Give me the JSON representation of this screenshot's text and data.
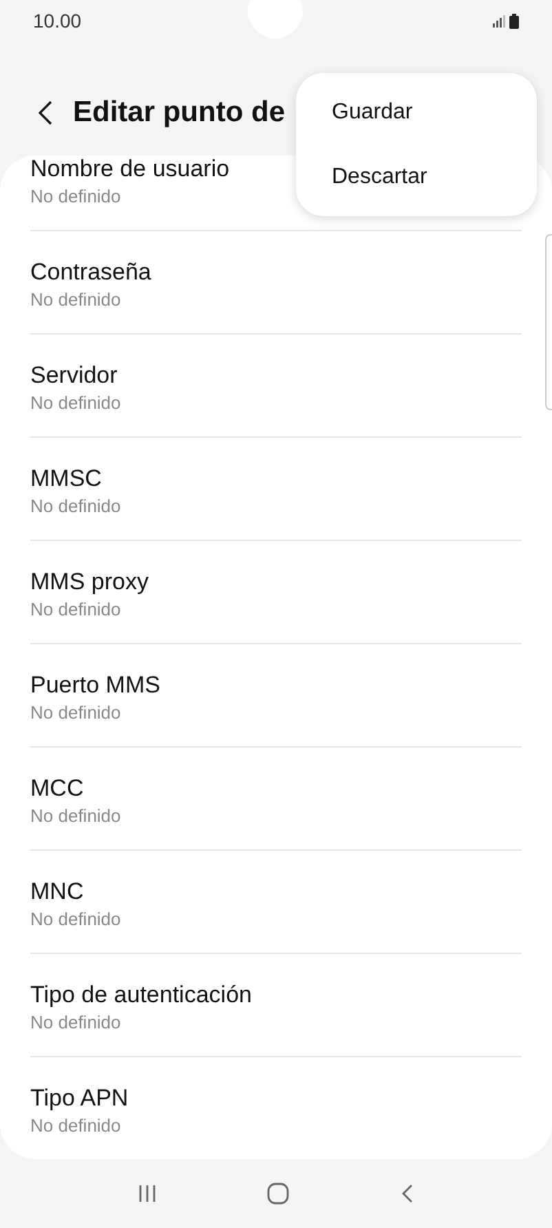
{
  "status_bar": {
    "time": "10.00"
  },
  "header": {
    "title": "Editar punto de"
  },
  "menu": {
    "items": [
      "Guardar",
      "Descartar"
    ]
  },
  "settings": [
    {
      "label": "Nombre de usuario",
      "value": "No definido"
    },
    {
      "label": "Contraseña",
      "value": "No definido"
    },
    {
      "label": "Servidor",
      "value": "No definido"
    },
    {
      "label": "MMSC",
      "value": "No definido"
    },
    {
      "label": "MMS proxy",
      "value": "No definido"
    },
    {
      "label": "Puerto MMS",
      "value": "No definido"
    },
    {
      "label": "MCC",
      "value": "No definido"
    },
    {
      "label": "MNC",
      "value": "No definido"
    },
    {
      "label": "Tipo de autenticación",
      "value": "No definido"
    },
    {
      "label": "Tipo APN",
      "value": "No definido"
    }
  ]
}
